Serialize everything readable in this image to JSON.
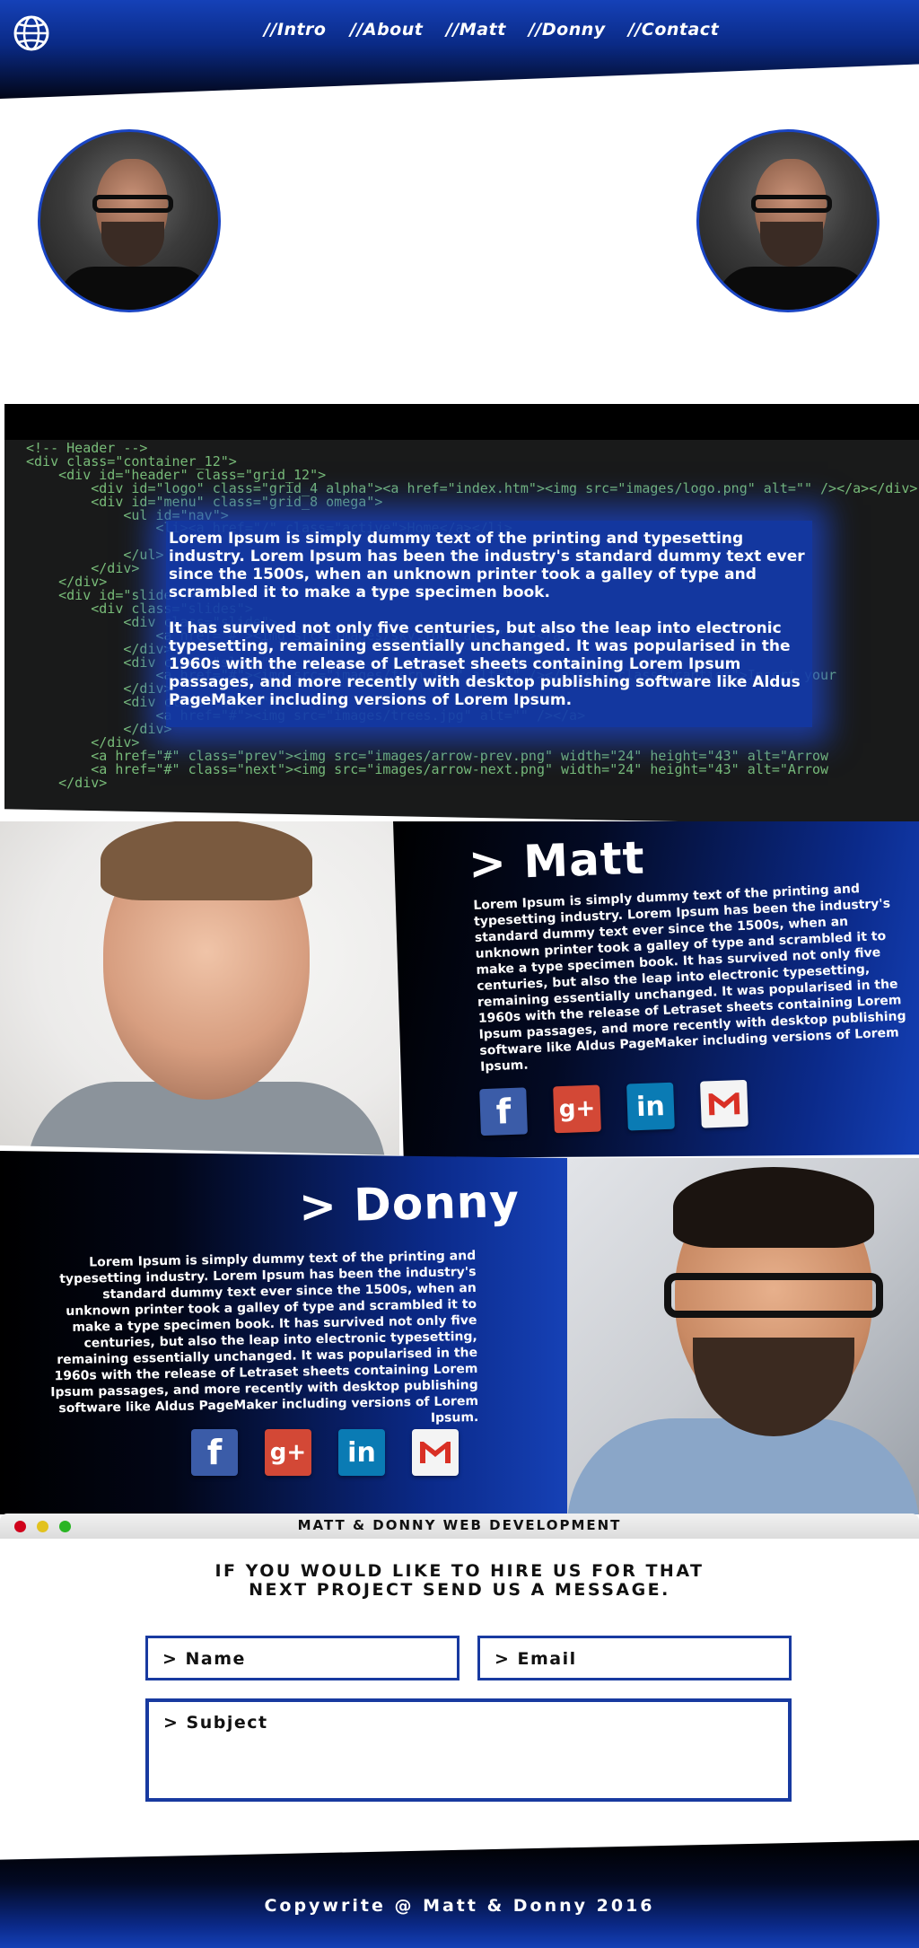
{
  "nav": {
    "items": [
      "//Intro",
      "//About",
      "//Matt",
      "//Donny",
      "//Contact"
    ]
  },
  "intro": {
    "paragraphs": [
      "Lorem Ipsum is simply dummy text of the printing and typesetting industry. Lorem Ipsum has been the industry's standard dummy text ever since the 1500s, when an unknown printer took a galley of type and scrambled it to make a type specimen book.",
      "It has survived not only five centuries, but also the leap into electronic typesetting, remaining essentially unchanged. It was popularised in the 1960s with the release of Letraset sheets containing Lorem Ipsum passages, and more recently with desktop publishing software like Aldus PageMaker including versions of Lorem Ipsum."
    ],
    "code_lines": [
      "<!-- Header -->",
      "<div class=\"container_12\">",
      "    <div id=\"header\" class=\"grid_12\">",
      "        <div id=\"logo\" class=\"grid_4 alpha\"><a href=\"index.htm\"><img src=\"images/logo.png\" alt=\"\" /></a></div>",
      "        <div id=\"menu\" class=\"grid_8 omega\">",
      "            <ul id=\"nav\">",
      "                <li><a href=\"/\" class=\"active\">Home</a></li>",
      "",
      "            </ul>",
      "        </div>",
      "    </div>",
      "    <div id=\"slider\">",
      "        <div class=\"slides\">",
      "            <div class=\"slide\">",
      "                <a href=\"#\"><img src=\"images/sky.jpg\" alt=\"\" /></a>",
      "            </div>",
      "            <div class=\"slide\">",
      "                <a href=\"#\"><img src=\"images/fern.jpg\" alt=\"\" /></a><div class=\"caption\">Insert your",
      "            </div>",
      "            <div class=\"slide\">",
      "                <a href=\"#\"><img src=\"images/trees.jpg\" alt=\"\" /></a>",
      "            </div>",
      "        </div>",
      "        <a href=\"#\" class=\"prev\"><img src=\"images/arrow-prev.png\" width=\"24\" height=\"43\" alt=\"Arrow",
      "        <a href=\"#\" class=\"next\"><img src=\"images/arrow-next.png\" width=\"24\" height=\"43\" alt=\"Arrow",
      "    </div>"
    ]
  },
  "matt": {
    "title": "> Matt",
    "bio": "Lorem Ipsum is simply dummy text of the printing and typesetting industry. Lorem Ipsum has been the industry's standard dummy text ever since the 1500s, when an unknown printer took a galley of type and scrambled it to make a type specimen book. It has survived not only five centuries, but also the leap into electronic typesetting, remaining essentially unchanged. It was popularised in the 1960s with the release of Letraset sheets containing Lorem Ipsum passages, and more recently with desktop publishing software like Aldus PageMaker including versions of Lorem Ipsum."
  },
  "donny": {
    "title": "> Donny",
    "bio": "Lorem Ipsum is simply dummy text of the printing and typesetting industry. Lorem Ipsum has been the industry's standard dummy text ever since the 1500s, when an unknown printer took a galley of type and scrambled it to make a type specimen book. It has survived not only five centuries, but also the leap into electronic typesetting, remaining essentially unchanged. It was popularised in the 1960s with the release of Letraset sheets containing Lorem Ipsum passages, and more recently with desktop publishing software like Aldus PageMaker including versions of Lorem Ipsum."
  },
  "social": {
    "icons": [
      "facebook-icon",
      "google-plus-icon",
      "linkedin-icon",
      "gmail-icon"
    ],
    "glyphs": {
      "facebook": "f",
      "google_plus": "g+",
      "linkedin": "in"
    }
  },
  "contact": {
    "window_title": "MATT & DONNY WEB DEVELOPMENT",
    "heading_line1": "IF YOU WOULD LIKE TO HIRE US FOR THAT",
    "heading_line2": "NEXT PROJECT SEND US A MESSAGE.",
    "name_placeholder": "> Name",
    "email_placeholder": "> Email",
    "subject_placeholder": "> Subject"
  },
  "footer": {
    "text": "Copywrite @ Matt & Donny 2016"
  },
  "colors": {
    "brand_blue": "#1440b6",
    "dark": "#000000",
    "field_border": "#183aa0"
  }
}
